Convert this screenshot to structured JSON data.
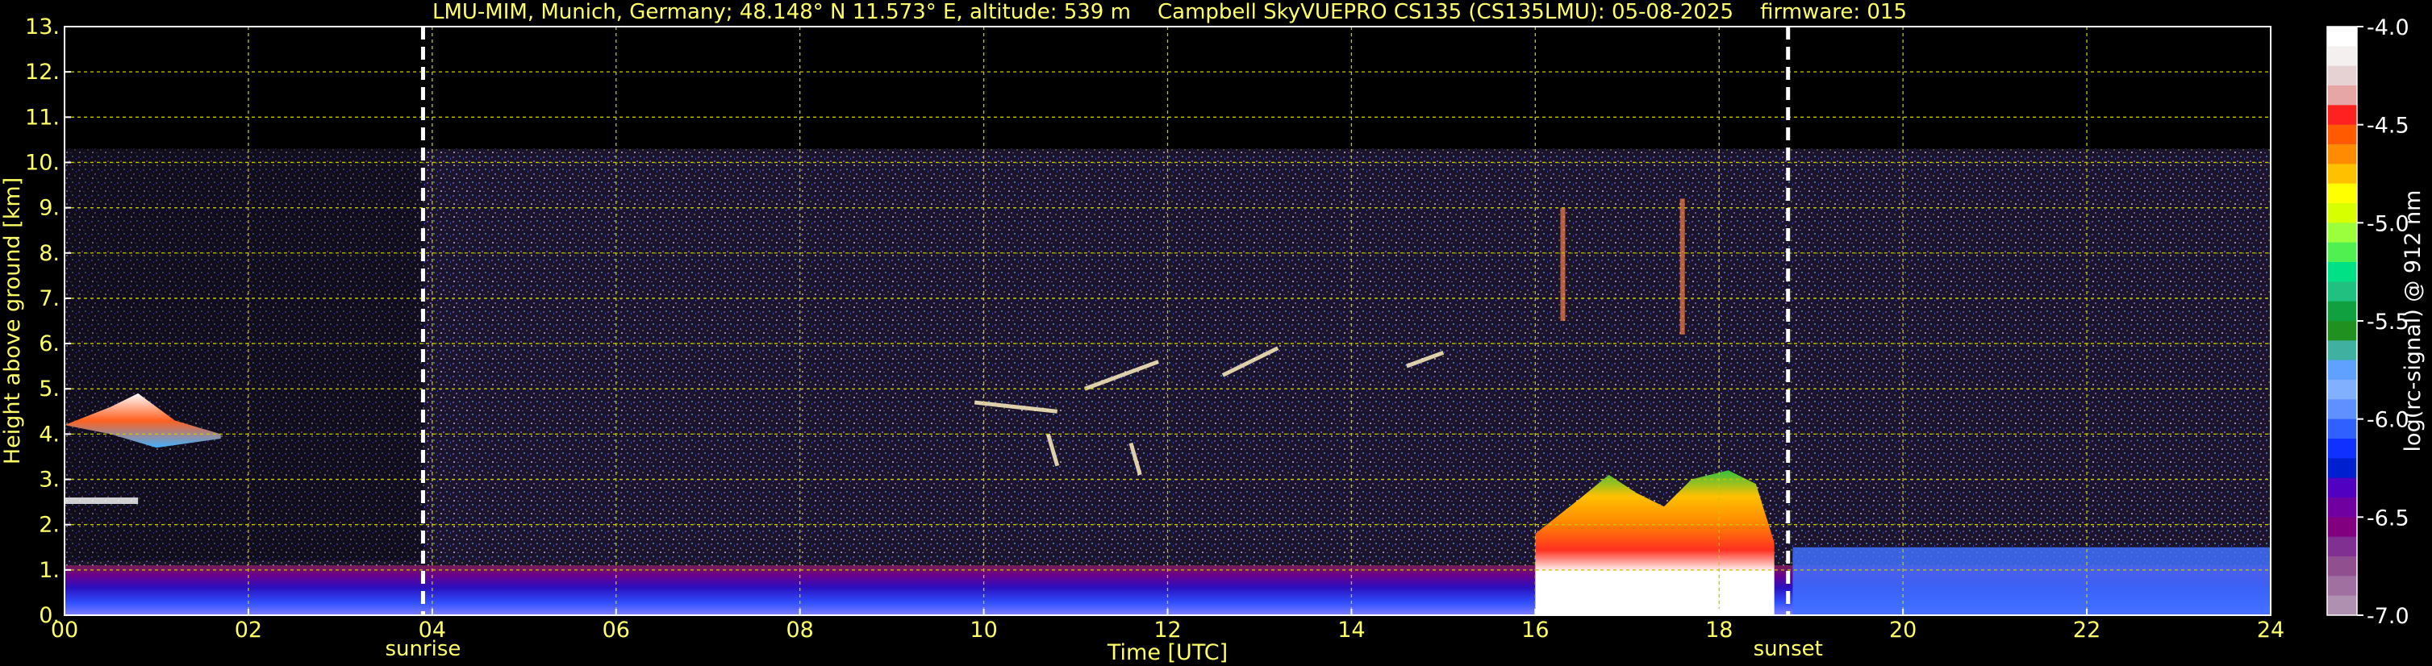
{
  "title": "LMU-MIM, Munich, Germany; 48.148° N 11.573° E, altitude: 539 m    Campbell SkyVUEPRO CS135 (CS135LMU): 05-08-2025    firmware: 015",
  "colors": {
    "text": "#ffff66",
    "grid": "#c8c800",
    "background": "#000000",
    "marker": "#ffffff"
  },
  "chart_data": {
    "type": "heatmap",
    "xlabel": "Time [UTC]",
    "ylabel": "Height above ground [km]",
    "xlim": [
      0,
      24
    ],
    "ylim": [
      0,
      13
    ],
    "x_ticks": [
      "00",
      "02",
      "04",
      "06",
      "08",
      "10",
      "12",
      "14",
      "16",
      "18",
      "20",
      "22",
      "24"
    ],
    "y_ticks": [
      "0.",
      "1.",
      "2.",
      "3.",
      "4.",
      "5.",
      "6.",
      "7.",
      "8.",
      "9.",
      "10.",
      "11.",
      "12.",
      "13."
    ],
    "grid": true,
    "markers": [
      {
        "label": "sunrise",
        "x": 3.9
      },
      {
        "label": "sunset",
        "x": 18.75
      }
    ],
    "colorbar": {
      "label": "log(rc-signal) @ 912 nm",
      "ticks": [
        "-4.0",
        "-4.5",
        "-5.0",
        "-5.5",
        "-6.0",
        "-6.5",
        "-7.0"
      ],
      "range": [
        -7.0,
        -4.0
      ],
      "colors": [
        "#ffffff",
        "#f4f0f0",
        "#e6d2d2",
        "#e6a6a6",
        "#ff2020",
        "#ff5a00",
        "#ff8c00",
        "#ffc000",
        "#ffff00",
        "#d8ff00",
        "#9cff3c",
        "#50f050",
        "#00e084",
        "#20c080",
        "#10a040",
        "#209020",
        "#40b0a0",
        "#60a0ff",
        "#80b0ff",
        "#6090ff",
        "#3060ff",
        "#1030ff",
        "#0020d0",
        "#5000c0",
        "#7000a0",
        "#800080",
        "#803090",
        "#905090",
        "#a070a0",
        "#b090b0"
      ]
    }
  }
}
